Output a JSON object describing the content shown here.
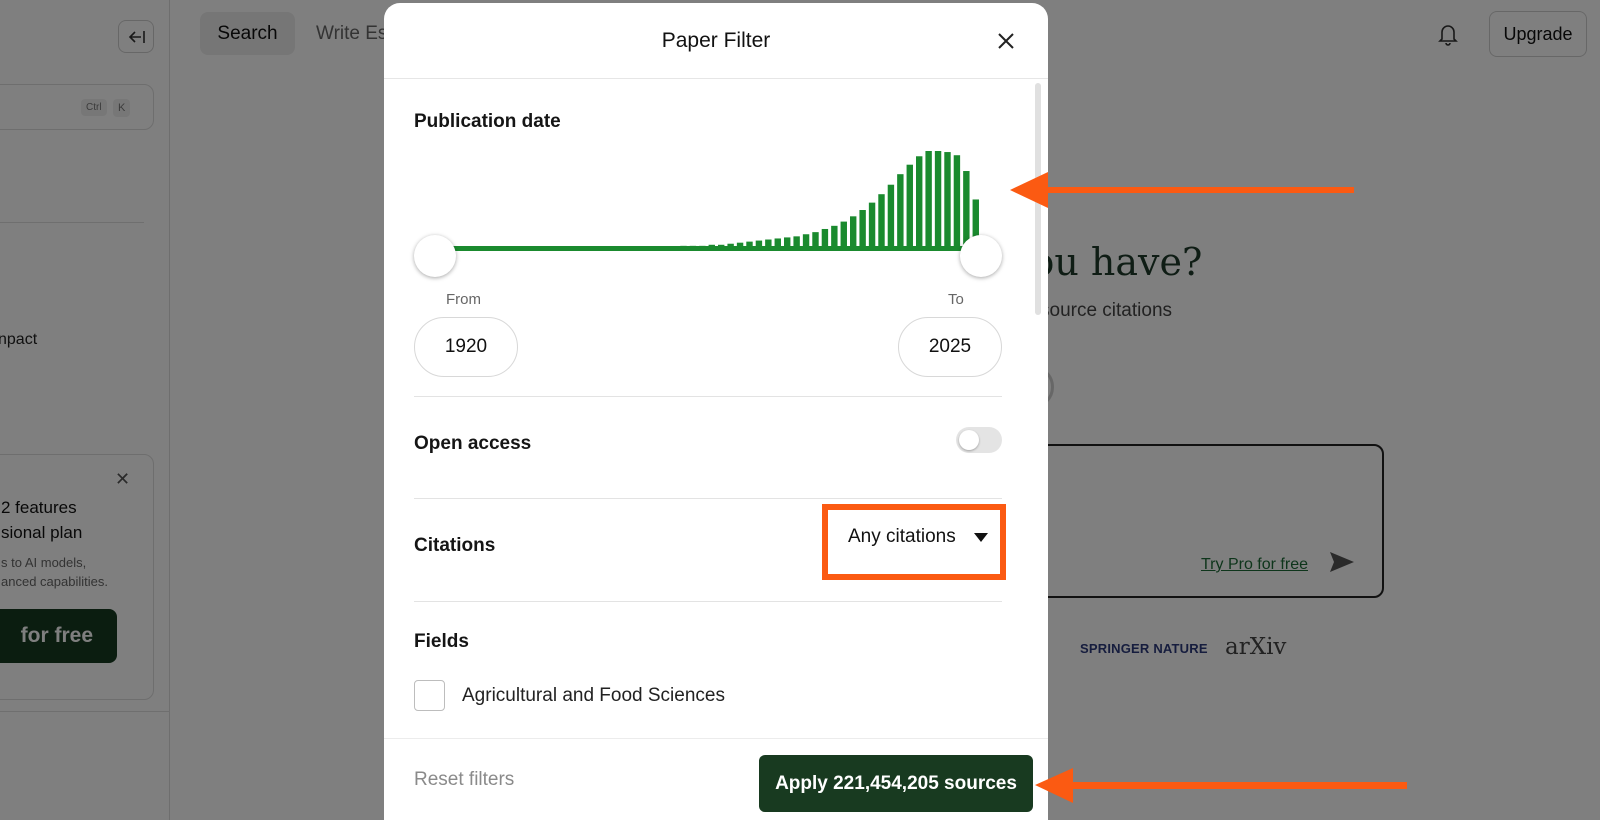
{
  "background": {
    "sidebar": {
      "shortcut_ctrl": "Ctrl",
      "shortcut_key": "K",
      "impact_text": "npact",
      "promo": {
        "title_line1": "2 features",
        "title_line2": "sional plan",
        "desc_line1": "s to AI models,",
        "desc_line2": "anced capabilities.",
        "button_label": "for free"
      }
    },
    "topnav": {
      "search_tab": "Search",
      "write_tab": "Write Es",
      "upgrade_label": "Upgrade"
    },
    "hero": {
      "title": "you have?",
      "subtitle": "source citations",
      "try_pro_link": "Try Pro for free"
    },
    "logos": {
      "springer": "SPRINGER NATURE",
      "arxiv": "arXiv"
    }
  },
  "modal": {
    "title": "Paper Filter",
    "publication_date": {
      "label": "Publication date",
      "histogram_values": [
        1,
        1,
        1,
        1,
        1,
        1,
        1,
        1,
        1,
        1,
        1,
        1,
        1,
        1,
        1,
        1,
        1,
        1,
        1,
        1,
        2,
        2,
        2,
        2,
        3,
        3,
        3,
        4,
        4,
        5,
        6,
        7,
        8,
        9,
        10,
        11,
        12,
        14,
        16,
        19,
        22,
        26,
        31,
        37,
        44,
        52,
        61,
        71,
        80,
        88,
        93,
        93,
        92,
        89,
        74,
        47
      ],
      "from_label": "From",
      "to_label": "To",
      "from_year": "1920",
      "to_year": "2025"
    },
    "open_access": {
      "label": "Open access",
      "enabled": false
    },
    "citations": {
      "label": "Citations",
      "selected": "Any citations"
    },
    "fields": {
      "label": "Fields",
      "items": [
        {
          "label": "Agricultural and Food Sciences",
          "checked": false
        }
      ]
    },
    "footer": {
      "reset_label": "Reset filters",
      "apply_label": "Apply 221,454,205 sources"
    }
  },
  "colors": {
    "histogram_green": "#1a8a2e",
    "apply_button": "#183a20",
    "highlight_orange": "#fb5a12"
  }
}
